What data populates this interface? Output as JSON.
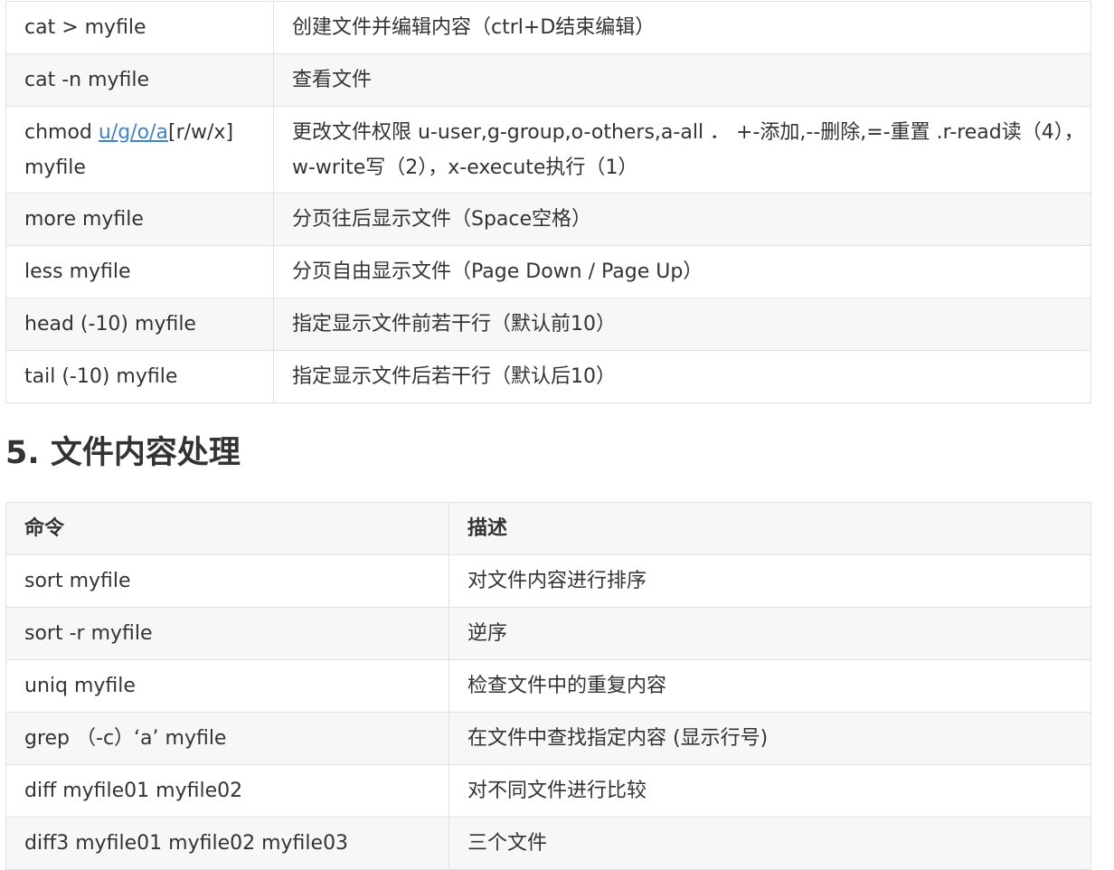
{
  "table1": {
    "rows": [
      {
        "cmd": "cat > myfile",
        "desc": "创建文件并编辑内容（ctrl+D结束编辑）"
      },
      {
        "cmd": "cat -n myfile",
        "desc": "查看文件"
      },
      {
        "cmd_prefix": "chmod ",
        "cmd_link": "u/g/o/a",
        "cmd_suffix": "[r/w/x] myfile",
        "desc": "更改文件权限 u-user,g-group,o-others,a-all ． +-添加,--删除,=-重置 .r-read读（4），w-write写（2），x-execute执行（1）"
      },
      {
        "cmd": "more myfile",
        "desc": "分页往后显示文件（Space空格）"
      },
      {
        "cmd": "less myfile",
        "desc": "分页自由显示文件（Page Down / Page Up）"
      },
      {
        "cmd": "head (-10) myfile",
        "desc": "指定显示文件前若干行（默认前10）"
      },
      {
        "cmd": "tail (-10) myfile",
        "desc": "指定显示文件后若干行（默认后10）"
      }
    ]
  },
  "section": {
    "heading": "5. 文件内容处理"
  },
  "table2": {
    "headers": [
      "命令",
      "描述"
    ],
    "rows": [
      {
        "cmd": "sort myfile",
        "desc": "对文件内容进行排序"
      },
      {
        "cmd": "sort -r myfile",
        "desc": "逆序"
      },
      {
        "cmd": "uniq myfile",
        "desc": "检查文件中的重复内容"
      },
      {
        "cmd": "grep （-c）‘a’ myfile",
        "desc": "在文件中查找指定内容 (显示行号)"
      },
      {
        "cmd": "diff myfile01 myfile02",
        "desc": "对不同文件进行比较"
      },
      {
        "cmd": "diff3 myfile01 myfile02 myfile03",
        "desc": "三个文件"
      }
    ]
  }
}
